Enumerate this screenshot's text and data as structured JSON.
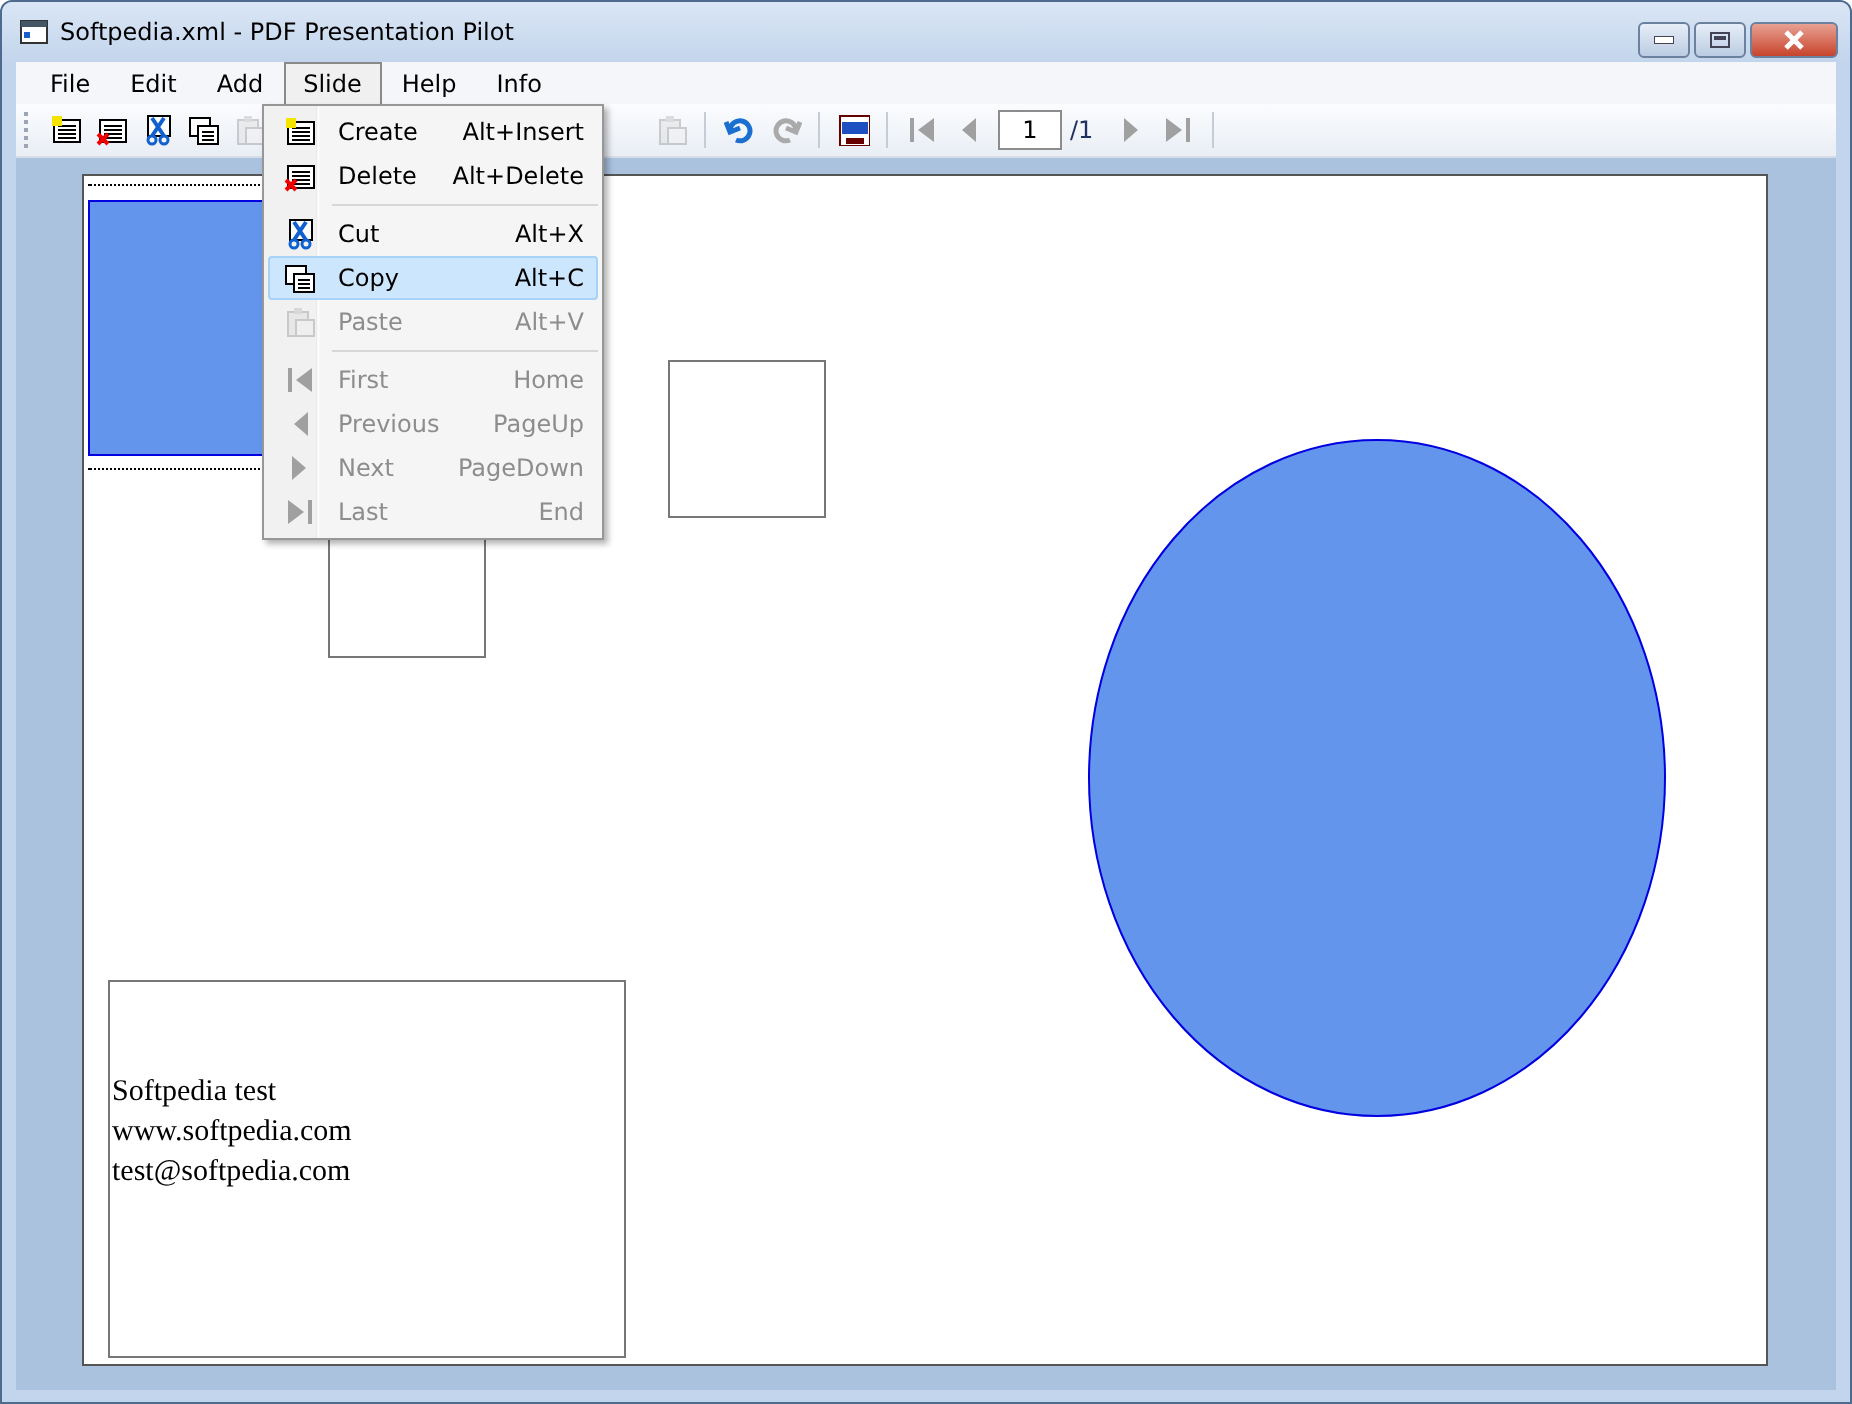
{
  "window": {
    "title": "Softpedia.xml - PDF Presentation Pilot"
  },
  "menu": [
    {
      "label": "File",
      "selected": false
    },
    {
      "label": "Edit",
      "selected": false
    },
    {
      "label": "Add",
      "selected": false
    },
    {
      "label": "Slide",
      "selected": true
    },
    {
      "label": "Help",
      "selected": false
    },
    {
      "label": "Info",
      "selected": false
    }
  ],
  "toolbar": {
    "left": [
      {
        "kind": "new",
        "disabled": false
      },
      {
        "kind": "delete",
        "disabled": false
      },
      {
        "kind": "cut",
        "disabled": false
      },
      {
        "kind": "copy",
        "disabled": false
      },
      {
        "kind": "paste",
        "disabled": true
      }
    ],
    "right": [
      {
        "kind": "paste",
        "disabled": true
      },
      {
        "kind": "sep"
      },
      {
        "kind": "undo",
        "disabled": false
      },
      {
        "kind": "redo",
        "disabled": true
      },
      {
        "kind": "sep"
      },
      {
        "kind": "pdf",
        "disabled": false
      },
      {
        "kind": "sep"
      },
      {
        "kind": "first",
        "disabled": true
      },
      {
        "kind": "prev",
        "disabled": true
      }
    ],
    "page_field": {
      "value": "1"
    },
    "page_total": "/1",
    "after": [
      {
        "kind": "next",
        "disabled": true
      },
      {
        "kind": "last",
        "disabled": true
      },
      {
        "kind": "sep"
      }
    ]
  },
  "dropdown": [
    {
      "kind": "new",
      "label": "Create",
      "shortcut": "Alt+Insert",
      "disabled": false,
      "selected": false
    },
    {
      "kind": "delete",
      "label": "Delete",
      "shortcut": "Alt+Delete",
      "disabled": false,
      "selected": false
    },
    {
      "kind": "separator"
    },
    {
      "kind": "cut",
      "label": "Cut",
      "shortcut": "Alt+X",
      "disabled": false,
      "selected": false
    },
    {
      "kind": "copy",
      "label": "Copy",
      "shortcut": "Alt+C",
      "disabled": false,
      "selected": true
    },
    {
      "kind": "paste",
      "label": "Paste",
      "shortcut": "Alt+V",
      "disabled": true,
      "selected": false
    },
    {
      "kind": "separator"
    },
    {
      "kind": "first",
      "label": "First",
      "shortcut": "Home",
      "disabled": true,
      "selected": false
    },
    {
      "kind": "prev",
      "label": "Previous",
      "shortcut": "PageUp",
      "disabled": true,
      "selected": false
    },
    {
      "kind": "next",
      "label": "Next",
      "shortcut": "PageDown",
      "disabled": true,
      "selected": false
    },
    {
      "kind": "last",
      "label": "Last",
      "shortcut": "End",
      "disabled": true,
      "selected": false
    }
  ],
  "slide": {
    "shapes": [
      {
        "kind": "selection"
      },
      {
        "kind": "rect"
      },
      {
        "kind": "rect"
      },
      {
        "kind": "ellipse"
      }
    ],
    "text_box": {
      "lines": [
        "Softpedia test",
        "www.softpedia.com",
        "test@softpedia.com"
      ]
    }
  }
}
